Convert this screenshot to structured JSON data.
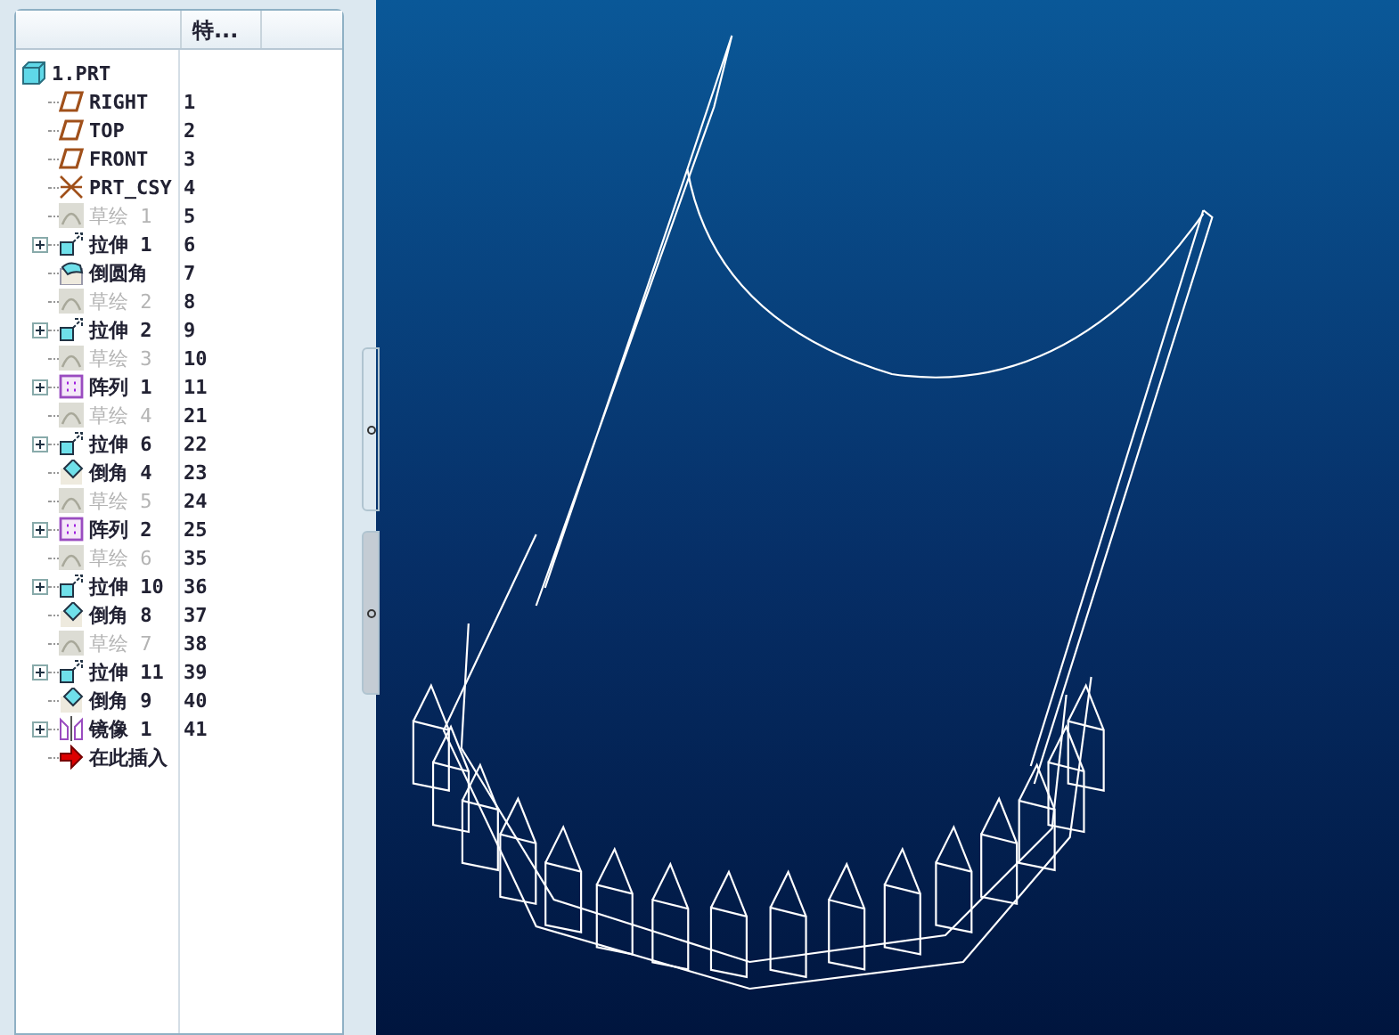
{
  "tree": {
    "column_header": "特...",
    "root": "1.PRT",
    "items": [
      {
        "kind": "plane",
        "name": "RIGHT",
        "number": "1",
        "dimmed": false,
        "expandable": false
      },
      {
        "kind": "plane",
        "name": "TOP",
        "number": "2",
        "dimmed": false,
        "expandable": false
      },
      {
        "kind": "plane",
        "name": "FRONT",
        "number": "3",
        "dimmed": false,
        "expandable": false
      },
      {
        "kind": "csys",
        "name": "PRT_CSY",
        "number": "4",
        "dimmed": false,
        "expandable": false
      },
      {
        "kind": "sketch",
        "name": "草绘 1",
        "number": "5",
        "dimmed": true,
        "expandable": false
      },
      {
        "kind": "extrude",
        "name": "拉伸 1",
        "number": "6",
        "dimmed": false,
        "expandable": true
      },
      {
        "kind": "round",
        "name": "倒圆角",
        "number": "7",
        "dimmed": false,
        "expandable": false
      },
      {
        "kind": "sketch",
        "name": "草绘 2",
        "number": "8",
        "dimmed": true,
        "expandable": false
      },
      {
        "kind": "extrude",
        "name": "拉伸 2",
        "number": "9",
        "dimmed": false,
        "expandable": true
      },
      {
        "kind": "sketch",
        "name": "草绘 3",
        "number": "10",
        "dimmed": true,
        "expandable": false
      },
      {
        "kind": "pattern",
        "name": "阵列 1",
        "number": "11",
        "dimmed": false,
        "expandable": true
      },
      {
        "kind": "sketch",
        "name": "草绘 4",
        "number": "21",
        "dimmed": true,
        "expandable": false
      },
      {
        "kind": "extrude",
        "name": "拉伸 6",
        "number": "22",
        "dimmed": false,
        "expandable": true
      },
      {
        "kind": "chamfer",
        "name": "倒角 4",
        "number": "23",
        "dimmed": false,
        "expandable": false
      },
      {
        "kind": "sketch",
        "name": "草绘 5",
        "number": "24",
        "dimmed": true,
        "expandable": false
      },
      {
        "kind": "pattern",
        "name": "阵列 2",
        "number": "25",
        "dimmed": false,
        "expandable": true
      },
      {
        "kind": "sketch",
        "name": "草绘 6",
        "number": "35",
        "dimmed": true,
        "expandable": false
      },
      {
        "kind": "extrude",
        "name": "拉伸 10",
        "number": "36",
        "dimmed": false,
        "expandable": true
      },
      {
        "kind": "chamfer",
        "name": "倒角 8",
        "number": "37",
        "dimmed": false,
        "expandable": false
      },
      {
        "kind": "sketch",
        "name": "草绘 7",
        "number": "38",
        "dimmed": true,
        "expandable": false
      },
      {
        "kind": "extrude",
        "name": "拉伸 11",
        "number": "39",
        "dimmed": false,
        "expandable": true
      },
      {
        "kind": "chamfer",
        "name": "倒角 9",
        "number": "40",
        "dimmed": false,
        "expandable": false
      },
      {
        "kind": "mirror",
        "name": "镜像 1",
        "number": "41",
        "dimmed": false,
        "expandable": true
      },
      {
        "kind": "insert",
        "name": "在此插入",
        "dimmed": false,
        "expandable": false
      }
    ]
  }
}
